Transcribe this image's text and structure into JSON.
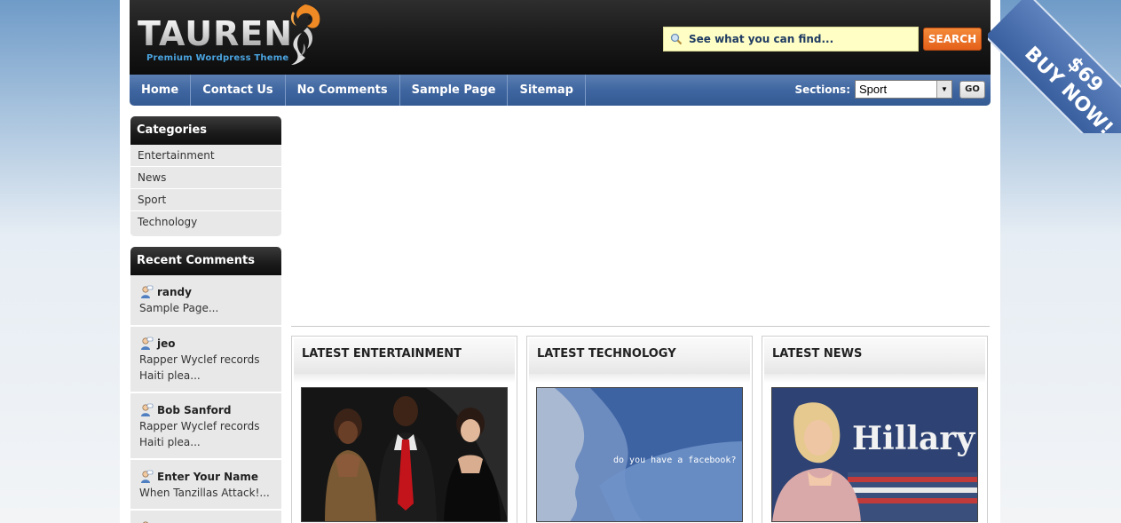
{
  "brand": {
    "name": "TAUREN",
    "tagline": "Premium Wordpress Theme"
  },
  "search": {
    "placeholder": "See what you can find...",
    "button_label": "SEARCH"
  },
  "nav": {
    "items": [
      {
        "label": "Home"
      },
      {
        "label": "Contact Us"
      },
      {
        "label": "No Comments"
      },
      {
        "label": "Sample Page"
      },
      {
        "label": "Sitemap"
      }
    ],
    "sections_label": "Sections:",
    "sections_selected": "Sport",
    "go_label": "GO"
  },
  "sidebar": {
    "categories_title": "Categories",
    "categories": [
      {
        "label": "Entertainment"
      },
      {
        "label": "News"
      },
      {
        "label": "Sport"
      },
      {
        "label": "Technology"
      }
    ],
    "comments_title": "Recent Comments",
    "comments": [
      {
        "author": "randy",
        "text": "Sample Page..."
      },
      {
        "author": "jeo",
        "text": "Rapper Wyclef records Haiti plea..."
      },
      {
        "author": "Bob Sanford",
        "text": "Rapper Wyclef records Haiti plea..."
      },
      {
        "author": "Enter Your Name",
        "text": "When Tanzillas Attack!..."
      }
    ]
  },
  "boxes": [
    {
      "title": "LATEST ENTERTAINMENT"
    },
    {
      "title": "LATEST TECHNOLOGY",
      "image_caption": "do you have a facebook?"
    },
    {
      "title": "LATEST NEWS",
      "image_caption": "Hillary"
    }
  ],
  "promo": {
    "price": "$69",
    "label": "BUY NOW!"
  },
  "colors": {
    "nav_blue": "#3f66a0",
    "search_orange": "#e4601a",
    "search_bg": "#fffec4",
    "tagline_blue": "#4aa3df"
  }
}
